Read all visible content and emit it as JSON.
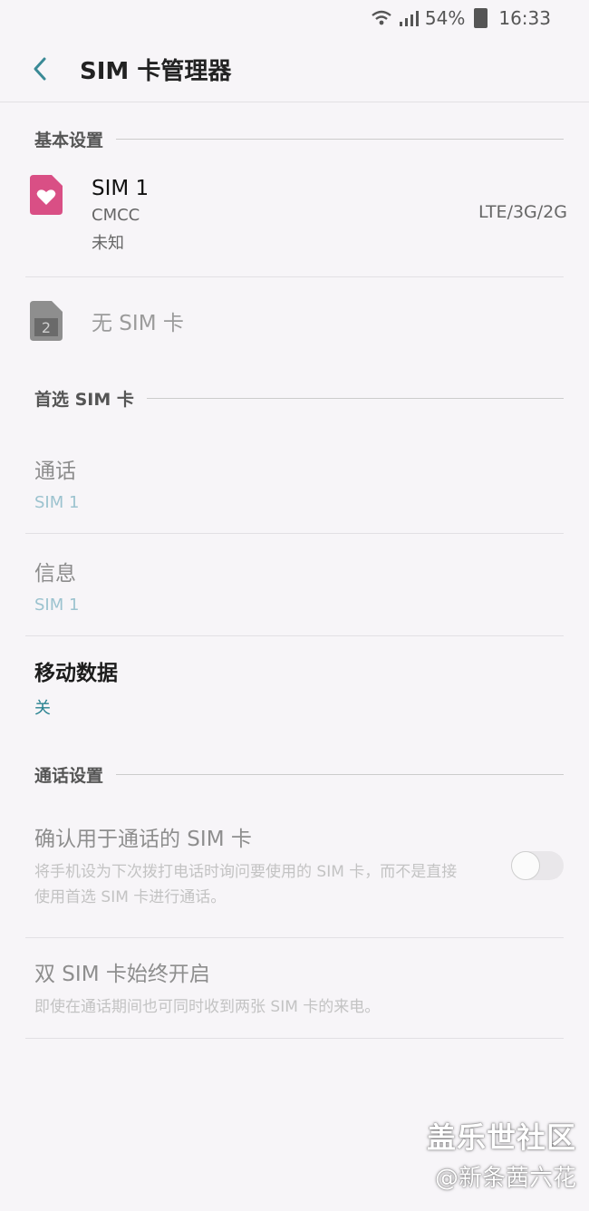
{
  "status_bar": {
    "battery": "54%",
    "time": "16:33"
  },
  "header": {
    "title": "SIM 卡管理器"
  },
  "sections": {
    "basic": "基本设置",
    "preferred": "首选 SIM 卡",
    "call_settings": "通话设置"
  },
  "sim1": {
    "name": "SIM 1",
    "carrier": "CMCC",
    "status": "未知",
    "network": "LTE/3G/2G",
    "color": "#d94f85"
  },
  "sim2": {
    "label": "无 SIM 卡",
    "badge": "2"
  },
  "preferred": {
    "call": {
      "title": "通话",
      "value": "SIM 1"
    },
    "message": {
      "title": "信息",
      "value": "SIM 1"
    },
    "mobile_data": {
      "title": "移动数据",
      "value": "关"
    }
  },
  "call_settings": {
    "confirm": {
      "title": "确认用于通话的 SIM 卡",
      "description": "将手机设为下次拨打电话时询问要使用的 SIM 卡，而不是直接使用首选 SIM 卡进行通话。",
      "enabled": false
    },
    "dual_sim": {
      "title": "双 SIM 卡始终开启",
      "description": "即使在通话期间也可同时收到两张 SIM 卡的来电。"
    }
  },
  "watermark": {
    "title": "盖乐世社区",
    "handle": "@新条茜六花"
  },
  "colors": {
    "accent": "#2a8391",
    "disabled_value": "#9cc3cf"
  }
}
